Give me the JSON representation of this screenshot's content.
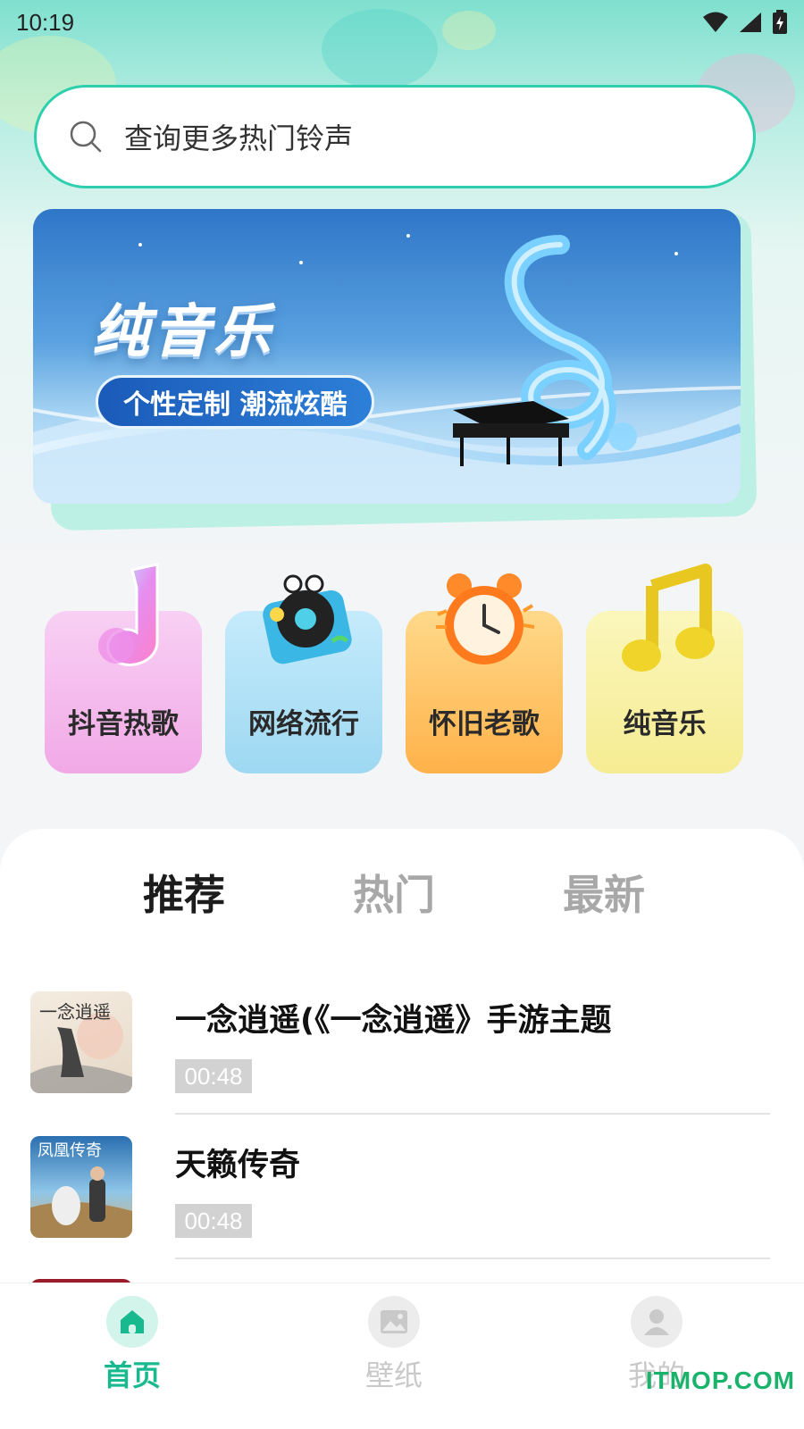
{
  "status_bar": {
    "time": "10:19"
  },
  "search": {
    "placeholder": "查询更多热门铃声"
  },
  "banner": {
    "title": "纯音乐",
    "tagline": "个性定制 潮流炫酷"
  },
  "categories": [
    {
      "label": "抖音热歌",
      "icon": "music-note-j-icon",
      "color": "#f5b9ee"
    },
    {
      "label": "网络流行",
      "icon": "turntable-icon",
      "color": "#a9def5"
    },
    {
      "label": "怀旧老歌",
      "icon": "alarm-clock-icon",
      "color": "#ffbd5c"
    },
    {
      "label": "纯音乐",
      "icon": "yellow-music-note-icon",
      "color": "#f8f0a0"
    }
  ],
  "tabs": [
    {
      "label": "推荐",
      "active": true
    },
    {
      "label": "热门",
      "active": false
    },
    {
      "label": "最新",
      "active": false
    }
  ],
  "songs": [
    {
      "title": "一念逍遥(《一念逍遥》手游主题",
      "duration": "00:48",
      "cover_text": "一念逍遥"
    },
    {
      "title": "天籁传奇",
      "duration": "00:48",
      "cover_text": "凤凰传奇"
    }
  ],
  "bottom_nav": [
    {
      "label": "首页",
      "icon": "home-icon",
      "active": true
    },
    {
      "label": "壁纸",
      "icon": "image-icon",
      "active": false
    },
    {
      "label": "我的",
      "icon": "user-icon",
      "active": false
    }
  ],
  "watermark": "ITMOP.COM",
  "colors": {
    "accent": "#2ecfae",
    "nav_active": "#18b98f",
    "nav_inactive": "#c9c9c9"
  }
}
